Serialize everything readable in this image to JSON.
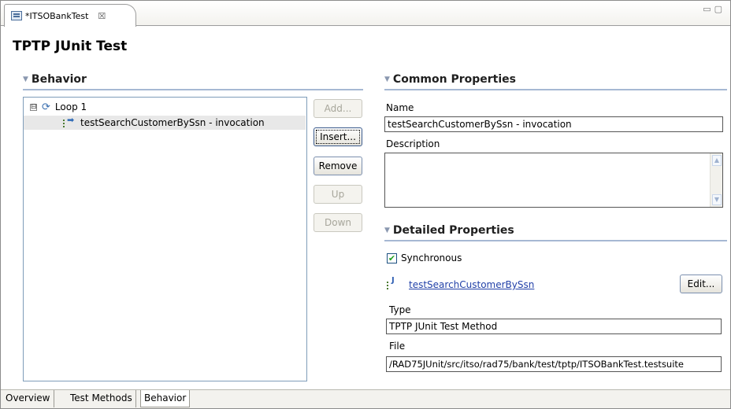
{
  "editor_tab": {
    "title": "*ITSOBankTest",
    "close_glyph": "☒"
  },
  "page_title": "TPTP JUnit Test",
  "behavior": {
    "heading": "Behavior",
    "tree": [
      {
        "label": "Loop 1",
        "expander": "⊟",
        "icon": "loop-icon"
      },
      {
        "label": "testSearchCustomerBySsn - invocation",
        "icon": "invocation-icon",
        "selected": true
      }
    ],
    "buttons": {
      "add": "Add...",
      "insert": "Insert...",
      "remove": "Remove",
      "up": "Up",
      "down": "Down"
    }
  },
  "common_properties": {
    "heading": "Common Properties",
    "name_label": "Name",
    "name_value": "testSearchCustomerBySsn - invocation",
    "description_label": "Description",
    "description_value": ""
  },
  "detailed_properties": {
    "heading": "Detailed Properties",
    "synchronous_label": "Synchronous",
    "synchronous_checked": true,
    "method_link": "testSearchCustomerBySsn",
    "edit_button": "Edit...",
    "type_label": "Type",
    "type_value": "TPTP JUnit Test Method",
    "file_label": "File",
    "file_value": "/RAD75JUnit/src/itso/rad75/bank/test/tptp/ITSOBankTest.testsuite"
  },
  "bottom_tabs": [
    {
      "label": "Overview",
      "active": false
    },
    {
      "label": "Test Methods",
      "active": false
    },
    {
      "label": "Behavior",
      "active": true
    }
  ],
  "colors": {
    "section_rule": "#a6b8d3",
    "link": "#2241a8",
    "check": "#21a121"
  }
}
